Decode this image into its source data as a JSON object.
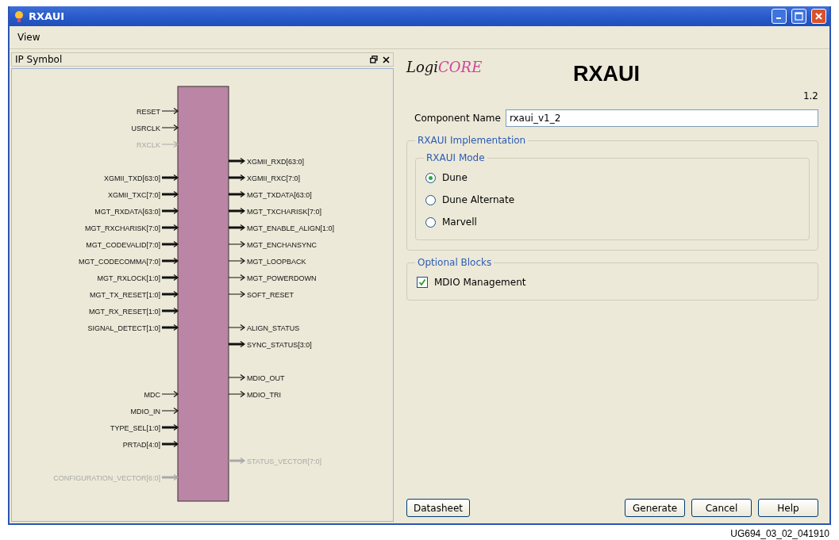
{
  "window": {
    "title": "RXAUI"
  },
  "menu": [
    {
      "label": "View"
    }
  ],
  "symbol_pane": {
    "title": "IP Symbol",
    "left_groups": [
      [
        {
          "name": "RESET",
          "kind": "single",
          "disabled": false
        },
        {
          "name": "USRCLK",
          "kind": "single",
          "disabled": false
        },
        {
          "name": "RXCLK",
          "kind": "single",
          "disabled": true
        }
      ],
      [
        {
          "name": "XGMII_TXD[63:0]",
          "kind": "bus",
          "disabled": false
        },
        {
          "name": "XGMII_TXC[7:0]",
          "kind": "bus",
          "disabled": false
        },
        {
          "name": "MGT_RXDATA[63:0]",
          "kind": "bus",
          "disabled": false
        },
        {
          "name": "MGT_RXCHARISK[7:0]",
          "kind": "bus",
          "disabled": false
        },
        {
          "name": "MGT_CODEVALID[7:0]",
          "kind": "bus",
          "disabled": false
        },
        {
          "name": "MGT_CODECOMMA[7:0]",
          "kind": "bus",
          "disabled": false
        },
        {
          "name": "MGT_RXLOCK[1:0]",
          "kind": "bus",
          "disabled": false
        },
        {
          "name": "MGT_TX_RESET[1:0]",
          "kind": "bus",
          "disabled": false
        },
        {
          "name": "MGT_RX_RESET[1:0]",
          "kind": "bus",
          "disabled": false
        },
        {
          "name": "SIGNAL_DETECT[1:0]",
          "kind": "bus",
          "disabled": false
        }
      ],
      [
        {
          "name": "MDC",
          "kind": "single",
          "disabled": false
        },
        {
          "name": "MDIO_IN",
          "kind": "single",
          "disabled": false
        },
        {
          "name": "TYPE_SEL[1:0]",
          "kind": "bus",
          "disabled": false
        },
        {
          "name": "PRTAD[4:0]",
          "kind": "bus",
          "disabled": false
        }
      ],
      [
        {
          "name": "CONFIGURATION_VECTOR[6:0]",
          "kind": "bus",
          "disabled": true
        }
      ]
    ],
    "right_groups": [
      [
        {
          "name": "XGMII_RXD[63:0]",
          "kind": "bus",
          "disabled": false
        },
        {
          "name": "XGMII_RXC[7:0]",
          "kind": "bus",
          "disabled": false
        },
        {
          "name": "MGT_TXDATA[63:0]",
          "kind": "bus",
          "disabled": false
        },
        {
          "name": "MGT_TXCHARISK[7:0]",
          "kind": "bus",
          "disabled": false
        },
        {
          "name": "MGT_ENABLE_ALIGN[1:0]",
          "kind": "bus",
          "disabled": false
        },
        {
          "name": "MGT_ENCHANSYNC",
          "kind": "single",
          "disabled": false
        },
        {
          "name": "MGT_LOOPBACK",
          "kind": "single",
          "disabled": false
        },
        {
          "name": "MGT_POWERDOWN",
          "kind": "single",
          "disabled": false
        },
        {
          "name": "SOFT_RESET",
          "kind": "single",
          "disabled": false
        }
      ],
      [
        {
          "name": "ALIGN_STATUS",
          "kind": "single",
          "disabled": false
        },
        {
          "name": "SYNC_STATUS[3:0]",
          "kind": "bus",
          "disabled": false
        }
      ],
      [
        {
          "name": "MDIO_OUT",
          "kind": "single",
          "disabled": false
        },
        {
          "name": "MDIO_TRI",
          "kind": "single",
          "disabled": false
        }
      ],
      [
        {
          "name": "STATUS_VECTOR[7:0]",
          "kind": "bus",
          "disabled": true
        }
      ]
    ]
  },
  "config": {
    "logo": {
      "prefix": "Logi",
      "suffix": "CORE"
    },
    "title": "RXAUI",
    "version": "1.2",
    "component_name": {
      "label": "Component Name",
      "value": "rxaui_v1_2"
    },
    "implementation": {
      "title": "RXAUI Implementation",
      "mode": {
        "title": "RXAUI Mode",
        "options": [
          {
            "label": "Dune",
            "selected": true
          },
          {
            "label": "Dune Alternate",
            "selected": false
          },
          {
            "label": "Marvell",
            "selected": false
          }
        ]
      }
    },
    "optional_blocks": {
      "title": "Optional Blocks",
      "items": [
        {
          "label": "MDIO Management",
          "checked": true
        }
      ]
    },
    "buttons_left": [
      "Datasheet"
    ],
    "buttons_right": [
      "Generate",
      "Cancel",
      "Help"
    ]
  },
  "caption": "UG694_03_02_041910"
}
